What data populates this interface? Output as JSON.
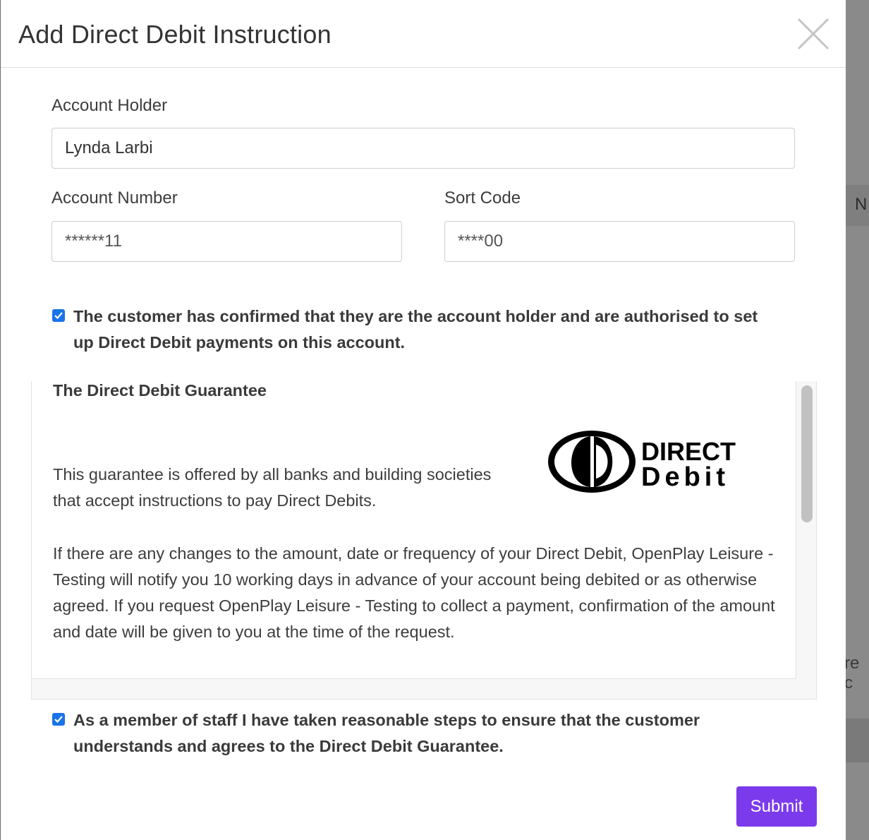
{
  "modal": {
    "title": "Add Direct Debit Instruction",
    "close_icon": "close-icon"
  },
  "form": {
    "account_holder": {
      "label": "Account Holder",
      "value": "Lynda Larbi"
    },
    "account_number": {
      "label": "Account Number",
      "placeholder": "******11"
    },
    "sort_code": {
      "label": "Sort Code",
      "placeholder": "****00"
    }
  },
  "confirm_holder": {
    "checked": true,
    "text": "The customer has confirmed that they are the account holder and are authorised to set up Direct Debit payments on this account."
  },
  "guarantee": {
    "title": "The Direct Debit Guarantee",
    "logo_text_1": "DIRECT",
    "logo_text_2": "Debit",
    "paragraph_1": "This guarantee is offered by all banks and building societies that accept instructions to pay Direct Debits.",
    "paragraph_2": "If there are any changes to the amount, date or frequency of your Direct Debit, OpenPlay Leisure - Testing will notify you 10 working days in advance of your account being debited or as otherwise agreed. If you request OpenPlay Leisure - Testing to collect a payment, confirmation of the amount and date will be given to you at the time of the request."
  },
  "confirm_staff": {
    "checked": true,
    "text": "As a member of staff I have taken reasonable steps to ensure that the customer understands and agrees to the Direct Debit Guarantee."
  },
  "actions": {
    "submit_label": "Submit"
  },
  "backdrop": {
    "fragment_1": "N",
    "fragment_2": "re c"
  },
  "colors": {
    "primary": "#7c3aed",
    "checkbox": "#1a73e8"
  }
}
